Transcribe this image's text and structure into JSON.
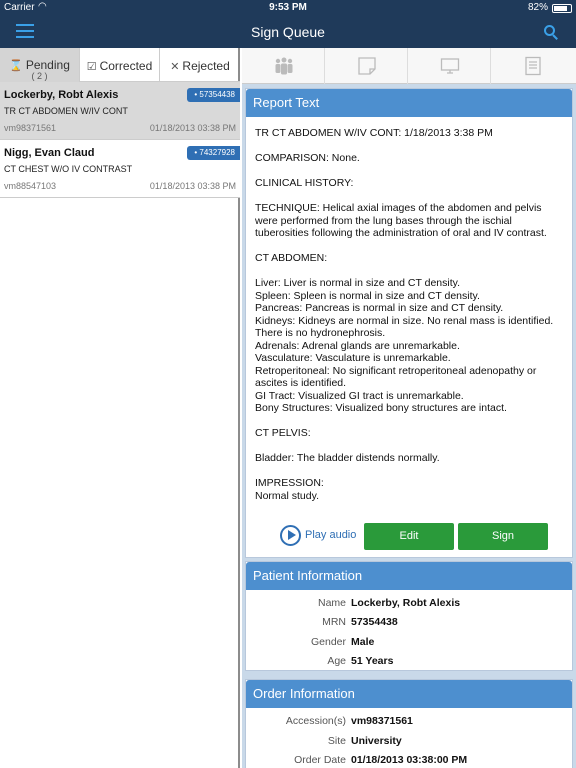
{
  "status_bar": {
    "carrier": "Carrier",
    "time": "9:53 PM",
    "battery": "82%",
    "battery_level": 0.82
  },
  "nav": {
    "title": "Sign Queue",
    "menu_icon": "hamburger-menu-icon",
    "search_icon": "search-icon"
  },
  "tabs": [
    {
      "label": "Pending",
      "count": "( 2 )",
      "icon": "hourglass-icon",
      "glyph": "⌛",
      "active": true
    },
    {
      "label": "Corrected",
      "count": "",
      "icon": "checkbox-icon",
      "glyph": "☑",
      "active": false
    },
    {
      "label": "Rejected",
      "count": "",
      "icon": "x-icon",
      "glyph": "✕",
      "active": false
    }
  ],
  "queue": [
    {
      "name": "Lockerby,  Robt Alexis",
      "procedure": "TR CT ABDOMEN W/IV CONT",
      "accession": "vm98371561",
      "date": "01/18/2013 03:38 PM",
      "mrn_badge": "• 57354438",
      "selected": true
    },
    {
      "name": "Nigg,  Evan Claud",
      "procedure": "CT CHEST W/O IV CONTRAST",
      "accession": "vm88547103",
      "date": "01/18/2013 03:38 PM",
      "mrn_badge": "• 74327928",
      "selected": false
    }
  ],
  "toolbar_icons": [
    "patients-icon",
    "note-icon",
    "monitor-icon",
    "document-list-icon"
  ],
  "report": {
    "header": "Report Text",
    "paragraphs": [
      "TR CT ABDOMEN W/IV CONT: 1/18/2013 3:38 PM",
      "COMPARISON: None.",
      "CLINICAL HISTORY:",
      "TECHNIQUE: Helical axial images of the abdomen and pelvis were performed from the lung bases through the ischial tuberosities following the administration of oral and IV contrast.",
      "CT ABDOMEN:",
      "Liver: Liver is normal in size and CT density.\nSpleen: Spleen is normal in size and CT density.\nPancreas: Pancreas is normal in size and CT density.\nKidneys: Kidneys are normal in size. No renal mass is identified.  There is no hydronephrosis.\nAdrenals: Adrenal glands are unremarkable.\nVasculature: Vasculature is unremarkable.\nRetroperitoneal: No significant retroperitoneal adenopathy or ascites is identified.\nGI Tract: Visualized GI tract is unremarkable.\nBony Structures: Visualized bony structures are intact.",
      "CT PELVIS:",
      "Bladder: The bladder distends normally.",
      "IMPRESSION:\nNormal study."
    ],
    "play_label": "Play audio",
    "edit_label": "Edit",
    "sign_label": "Sign"
  },
  "patient": {
    "header": "Patient Information",
    "rows": [
      {
        "label": "Name",
        "value": "Lockerby,  Robt Alexis"
      },
      {
        "label": "MRN",
        "value": "57354438"
      },
      {
        "label": "Gender",
        "value": "Male"
      },
      {
        "label": "Age",
        "value": "51 Years"
      }
    ]
  },
  "order": {
    "header": "Order Information",
    "rows": [
      {
        "label": "Accession(s)",
        "value": "vm98371561"
      },
      {
        "label": "Site",
        "value": "University"
      },
      {
        "label": "Order Date",
        "value": "01/18/2013 03:38:00 PM"
      }
    ]
  }
}
